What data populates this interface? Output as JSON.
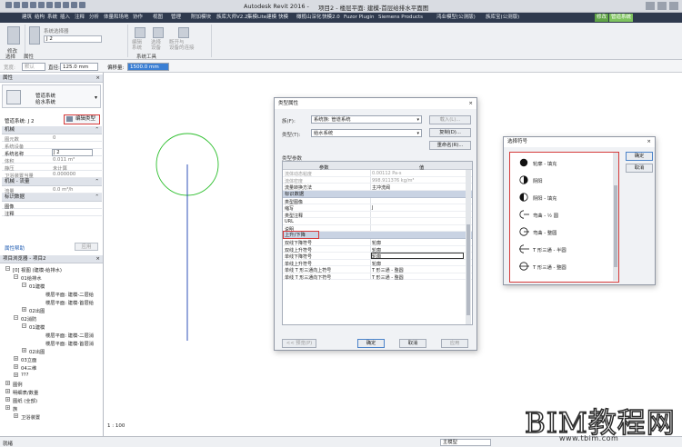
{
  "window": {
    "app_title": "Autodesk Revit 2016 -",
    "doc_title": "项目2 - 楼层平面: 建模-首层给排水平面图"
  },
  "ribbon_tabs": [
    "建筑",
    "结构",
    "系统",
    "插入",
    "注释",
    "分析",
    "体量和场地",
    "协作",
    "视图",
    "管理",
    "附加模块",
    "族库大师V2.2",
    "集模Lite建模",
    "快模",
    "橄榄山深化",
    "快模2.0",
    "Fuzor Plugin",
    "Siemens Products",
    "鸿业模型(公测版)",
    "族库宝(公测版)",
    "修改",
    "管道系统"
  ],
  "ribbon": {
    "modify_label": "修改",
    "properties_label": "属性",
    "system_selector_label": "系统选择器",
    "system_selector_value": "J 2",
    "tool_edit_system": "编辑\n系统",
    "tool_select_device": "选择\n设备",
    "tool_disconnect": "断开与\n设备的连接",
    "group_select": "选择",
    "group_properties": "属性",
    "group_system_tools": "系统工具"
  },
  "options_bar": {
    "width_label": "宽度:",
    "width_value": "默认",
    "diameter_label": "直径:",
    "diameter_value": "125.0 mm",
    "offset_label": "偏移量:",
    "offset_value": "1500.0 mm"
  },
  "properties": {
    "header": "属性",
    "close": "×",
    "type_line1": "管道系统",
    "type_line2": "给水系统",
    "system_label": "管道系统: J 2",
    "edit_type": "编辑类型",
    "group_mechanical": "机械",
    "group_mechanical_flow": "机械 - 流量",
    "group_identity": "标识数据",
    "collapse": "⌃",
    "rows_mech": [
      {
        "k": "图元数",
        "v": "0"
      },
      {
        "k": "系统设备",
        "v": ""
      },
      {
        "k": "系统名称",
        "v": "J 2"
      },
      {
        "k": "体积",
        "v": "0.011 m³"
      },
      {
        "k": "静压",
        "v": "未计算"
      },
      {
        "k": "卫浴装置当量",
        "v": "0.000000"
      }
    ],
    "rows_flow": [
      {
        "k": "流量",
        "v": "0.0 m³/h"
      }
    ],
    "rows_identity": [
      {
        "k": "图像",
        "v": ""
      },
      {
        "k": "注释",
        "v": ""
      }
    ],
    "help": "属性帮助",
    "apply": "应用"
  },
  "browser": {
    "header": "项目浏览器 - 项目2",
    "close": "×",
    "items": [
      {
        "t": "[0] 视图 (建模-给排水)",
        "i": 0,
        "tog": "−"
      },
      {
        "t": "01给排水",
        "i": 1,
        "tog": "−"
      },
      {
        "t": "01建模",
        "i": 2,
        "tog": "−"
      },
      {
        "t": "楼层平面: 建模-二层给",
        "i": 4,
        "tog": ""
      },
      {
        "t": "楼层平面: 建模-首层给",
        "i": 4,
        "tog": ""
      },
      {
        "t": "02出图",
        "i": 2,
        "tog": "+"
      },
      {
        "t": "02消防",
        "i": 1,
        "tog": "−"
      },
      {
        "t": "01建模",
        "i": 2,
        "tog": "−"
      },
      {
        "t": "楼层平面: 建模-二层消",
        "i": 4,
        "tog": ""
      },
      {
        "t": "楼层平面: 建模-首层消",
        "i": 4,
        "tog": ""
      },
      {
        "t": "02出图",
        "i": 2,
        "tog": "+"
      },
      {
        "t": "03立面",
        "i": 1,
        "tog": "+"
      },
      {
        "t": "04三维",
        "i": 1,
        "tog": "+"
      },
      {
        "t": "???",
        "i": 1,
        "tog": "+"
      },
      {
        "t": "图例",
        "i": 0,
        "tog": "+"
      },
      {
        "t": "明细表/数量",
        "i": 0,
        "tog": "+"
      },
      {
        "t": "图纸 (全部)",
        "i": 0,
        "tog": "+"
      },
      {
        "t": "族",
        "i": 0,
        "tog": "+"
      },
      {
        "t": "卫浴装置",
        "i": 1,
        "tog": "+"
      }
    ]
  },
  "type_dialog": {
    "title": "类型属性",
    "close": "×",
    "family_label": "族(F):",
    "family_value": "系统族: 管道系统",
    "type_label": "类型(T):",
    "type_value": "给水系统",
    "load": "载入(L)...",
    "duplicate": "复制(D)...",
    "rename": "重命名(R)...",
    "type_params": "类型参数",
    "col_param": "参数",
    "col_value": "值",
    "rows_top": [
      {
        "k": "流体动态粘度",
        "v": "0.00112 Pa-s"
      },
      {
        "k": "流体密度",
        "v": "998.911376 kg/m³"
      },
      {
        "k": "流量转换方法",
        "v": "主冲洗阀",
        "dark": true
      }
    ],
    "group_identity": "标识数据",
    "rows_identity": [
      {
        "k": "类型图像",
        "v": ""
      },
      {
        "k": "缩写",
        "v": "J"
      },
      {
        "k": "类型注释",
        "v": ""
      },
      {
        "k": "URL",
        "v": ""
      },
      {
        "k": "说明",
        "v": ""
      }
    ],
    "group_updown": "上升/下降",
    "collapse": "⌃",
    "rows_updown": [
      {
        "k": "双线下降符号",
        "v": "轮廓"
      },
      {
        "k": "双线上升符号",
        "v": "轮廓"
      },
      {
        "k": "单线下降符号",
        "v": "轮廓",
        "sel": true
      },
      {
        "k": "单线上升符号",
        "v": "轮廓"
      },
      {
        "k": "单线 T 形三通向上符号",
        "v": "T 形三通 - 整圆"
      },
      {
        "k": "单线 T 形三通向下符号",
        "v": "T 形三通 - 整圆"
      }
    ],
    "preview": "<< 预览(P)",
    "ok": "确定",
    "cancel": "取消",
    "apply": "应用"
  },
  "symbol_dialog": {
    "title": "选择符号",
    "close": "×",
    "ok": "确定",
    "cancel": "取消",
    "symbols": [
      {
        "name": "轮廓 - 填充",
        "glyph": "filled-circle"
      },
      {
        "name": "阴阳",
        "glyph": "yinyang"
      },
      {
        "name": "阴阳 - 填充",
        "glyph": "yinyang-filled"
      },
      {
        "name": "弯曲 - ½ 圆",
        "glyph": "half-circle"
      },
      {
        "name": "弯曲 - 整圆",
        "glyph": "full-circle"
      },
      {
        "name": "T 形三通 - 半圆",
        "glyph": "tee-half"
      },
      {
        "name": "T 形三通 - 整圆",
        "glyph": "tee-full"
      }
    ]
  },
  "statusbar": {
    "ready": "就绪",
    "model": "主模型",
    "scale": "1 : 100"
  },
  "watermark": {
    "main": "BIM教程网",
    "url": "www.tbim.com"
  },
  "colors": {
    "circle": "#2dbf2d",
    "pipe": "#2f52b8",
    "highlight": "#d63a3a",
    "ribbon_dark": "#2f3a4e",
    "tab_green": "#5fa346"
  }
}
